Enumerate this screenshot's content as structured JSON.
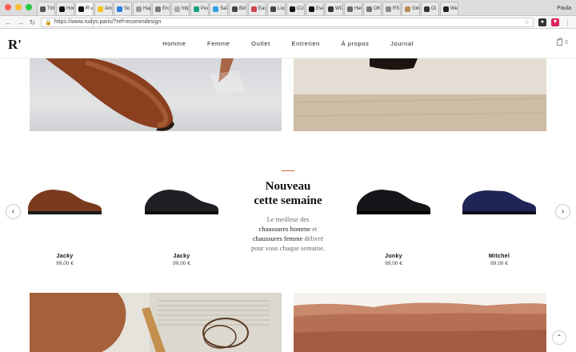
{
  "browser": {
    "tabs": [
      {
        "label": "Tim",
        "color": "#555555"
      },
      {
        "label": "Hor",
        "color": "#111111"
      },
      {
        "label": "R'",
        "color": "#111111",
        "active": true
      },
      {
        "label": "Anc",
        "color": "#f3c21b"
      },
      {
        "label": "So",
        "color": "#2b7de1"
      },
      {
        "label": "Hap",
        "color": "#999999"
      },
      {
        "label": "Erc",
        "color": "#777777"
      },
      {
        "label": "http",
        "color": "#aaaaaa"
      },
      {
        "label": "Pex",
        "color": "#1aa07d"
      },
      {
        "label": "Sal",
        "color": "#2aa0e6"
      },
      {
        "label": "Bill",
        "color": "#444444"
      },
      {
        "label": "Eas",
        "color": "#d2424e"
      },
      {
        "label": "Loc",
        "color": "#444444"
      },
      {
        "label": "CU",
        "color": "#111111"
      },
      {
        "label": "Eve",
        "color": "#111111"
      },
      {
        "label": "WC",
        "color": "#333333"
      },
      {
        "label": "Her",
        "color": "#666666"
      },
      {
        "label": "OK",
        "color": "#777777"
      },
      {
        "label": "RS",
        "color": "#888888"
      },
      {
        "label": "Gin",
        "color": "#b58a58"
      },
      {
        "label": "Oi",
        "color": "#333333"
      },
      {
        "label": "We",
        "color": "#222222"
      }
    ],
    "profile": "Paula",
    "url": "https://www.rudys.paris/?ref=ecommdesign"
  },
  "site": {
    "logo": "R'",
    "nav": [
      "Homme",
      "Femme",
      "Outlet",
      "Entretien",
      "À propos",
      "Journal"
    ],
    "cart_count": "0"
  },
  "products": [
    {
      "name": "Jacky",
      "price": "99,00 €",
      "color": "#7a3a1e"
    },
    {
      "name": "Jacky",
      "price": "99,00 €",
      "color": "#1e1f24"
    },
    {
      "name": "Junky",
      "price": "99,00 €",
      "color": "#15161a"
    },
    {
      "name": "Mitchel",
      "price": "89,00 €",
      "color": "#1f2556"
    }
  ],
  "promo": {
    "title_line1": "Nouveau",
    "title_line2": "cette semaine",
    "text_1": "Le meilleur des",
    "text_2": "chaussures homme",
    "text_3": " et",
    "text_4": "chaussures femme",
    "text_5": " délivré",
    "text_6": "pour vous chaque semaine."
  },
  "accent_color": "#c76b3a"
}
